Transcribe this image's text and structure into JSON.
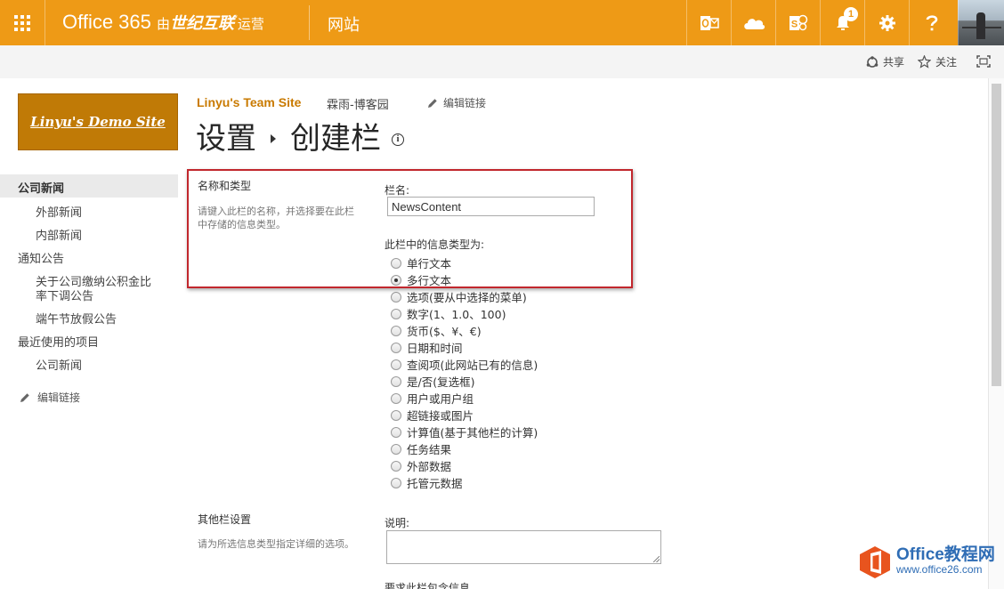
{
  "suite": {
    "brand_main": "Office 365 ",
    "brand_by": "由",
    "brand_company": "世纪互联",
    "brand_operate": "运营",
    "app_name": "网站",
    "notification_count": "1"
  },
  "commands": {
    "share": "共享",
    "follow": "关注"
  },
  "site": {
    "logo_text": "Linyu's Demo Site",
    "home_link": "Linyu's Team Site",
    "blog_link": "霖雨-博客园",
    "edit_links": "编辑链接"
  },
  "page": {
    "title_part1": "设置",
    "title_part2": "创建栏",
    "info_symbol": "i"
  },
  "leftnav": {
    "items": [
      {
        "label": "公司新闻"
      },
      {
        "label": "外部新闻"
      },
      {
        "label": "内部新闻"
      },
      {
        "label": "通知公告"
      },
      {
        "label": "关于公司缴纳公积金比"
      },
      {
        "label": "率下调公告"
      },
      {
        "label": "端午节放假公告"
      },
      {
        "label": "最近使用的项目"
      },
      {
        "label": "公司新闻"
      }
    ],
    "edit_links": "编辑链接"
  },
  "form": {
    "name_section": {
      "title": "名称和类型",
      "desc_line1": "请键入此栏的名称，并选择要在此栏",
      "desc_line2": "中存储的信息类型。"
    },
    "column_name_label": "栏名:",
    "column_name_value": "NewsContent",
    "type_label": "此栏中的信息类型为:",
    "types": [
      {
        "label": "单行文本",
        "checked": false
      },
      {
        "label": "多行文本",
        "checked": true
      },
      {
        "label": "选项(要从中选择的菜单)",
        "checked": false
      },
      {
        "label": "数字(1、1.0、100)",
        "checked": false
      },
      {
        "label": "货币($、¥、€)",
        "checked": false
      },
      {
        "label": "日期和时间",
        "checked": false
      },
      {
        "label": "查阅项(此网站已有的信息)",
        "checked": false
      },
      {
        "label": "是/否(复选框)",
        "checked": false
      },
      {
        "label": "用户或用户组",
        "checked": false
      },
      {
        "label": "超链接或图片",
        "checked": false
      },
      {
        "label": "计算值(基于其他栏的计算)",
        "checked": false
      },
      {
        "label": "任务结果",
        "checked": false
      },
      {
        "label": "外部数据",
        "checked": false
      },
      {
        "label": "托管元数据",
        "checked": false
      }
    ],
    "other_section": {
      "title": "其他栏设置",
      "desc": "请为所选信息类型指定详细的选项。"
    },
    "description_label": "说明:",
    "require_label": "要求此栏包含信息"
  },
  "watermark": {
    "main": "Office教程网",
    "sub": "www.office26.com"
  },
  "colors": {
    "suite_orange": "#ee9a16",
    "logo_brown": "#c07a06",
    "highlight_red": "#c1272d"
  }
}
